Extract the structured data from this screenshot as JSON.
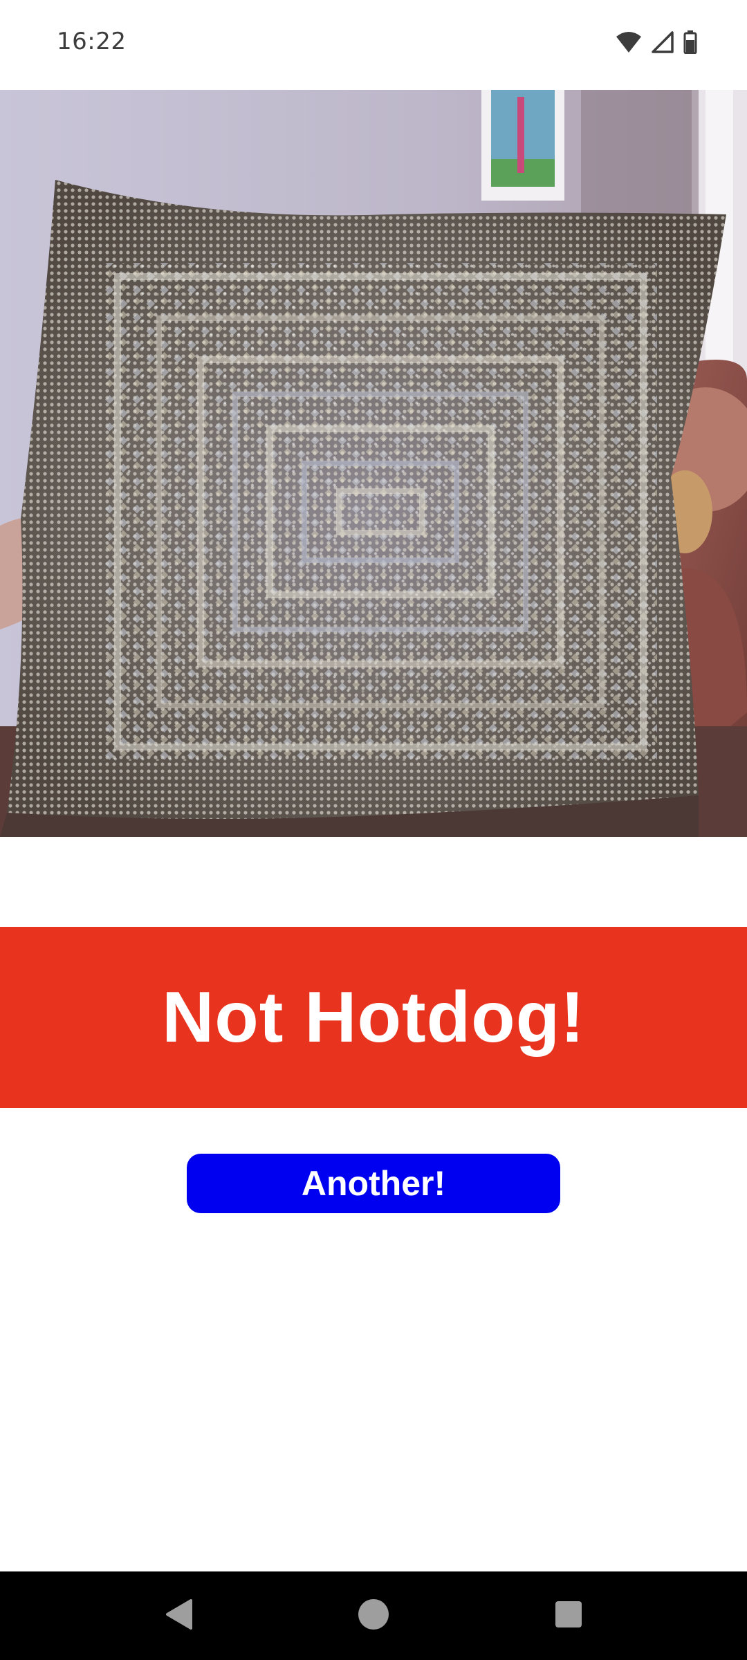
{
  "status_bar": {
    "time": "16:22",
    "icons": [
      "wifi-icon",
      "cell-signal-icon",
      "battery-icon"
    ]
  },
  "photo": {
    "subject": "sequined-cushion-photo"
  },
  "result": {
    "label": "Not Hotdog!",
    "background_color": "#E8341F"
  },
  "another_button": {
    "label": "Another!",
    "background_color": "#0000F0"
  },
  "nav_bar": {
    "icons": [
      "back-icon",
      "home-icon",
      "recents-icon"
    ]
  }
}
